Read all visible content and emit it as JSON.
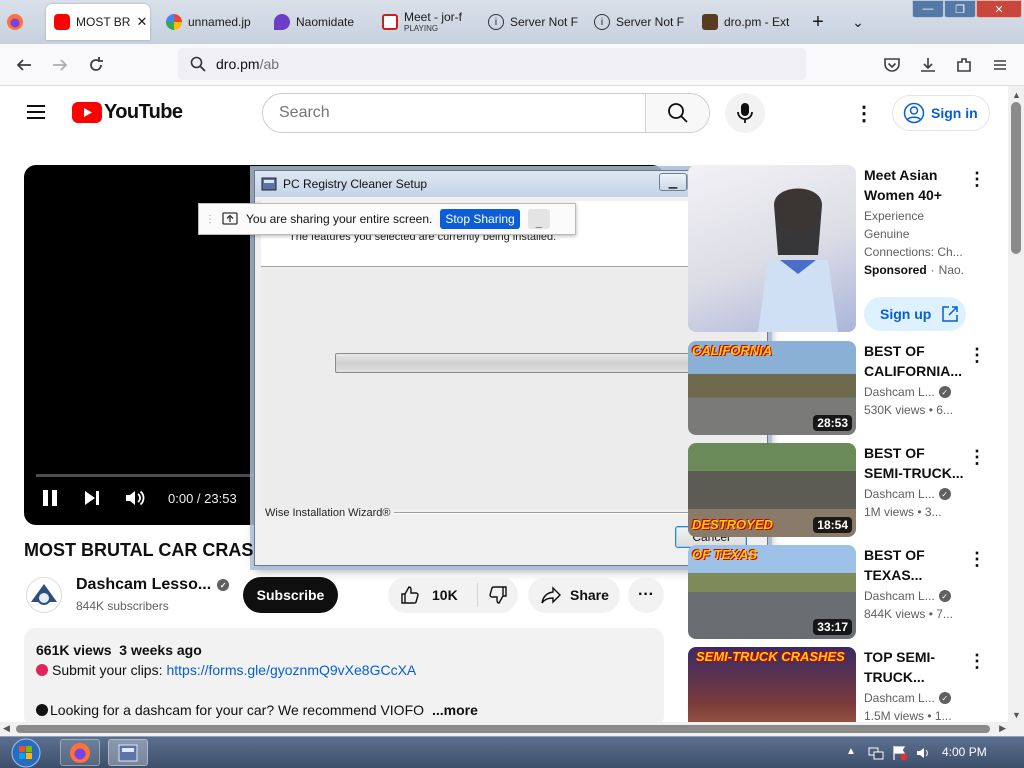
{
  "browser": {
    "tabs": [
      {
        "label": "MOST BR",
        "active": true
      },
      {
        "label": "unnamed.jp"
      },
      {
        "label": "Naomidate"
      },
      {
        "label": "Meet - jor-f",
        "sub": "PLAYING"
      },
      {
        "label": "Server Not F"
      },
      {
        "label": "Server Not F"
      },
      {
        "label": "dro.pm - Ext"
      }
    ],
    "url_host": "dro.pm",
    "url_path": "/ab"
  },
  "youtube": {
    "logo_text": "YouTube",
    "search_placeholder": "Search",
    "sign_in": "Sign in"
  },
  "player": {
    "time": "0:00 / 23:53",
    "progress": 0.0
  },
  "dialog": {
    "title": "PC Registry Cleaner Setup",
    "header_text": "The features you selected are currently being installed.",
    "footer_label": "Wise Installation Wizard®",
    "cancel": "Cancel",
    "progress": 0.0
  },
  "share_bar": {
    "message": "You are sharing your entire screen.",
    "stop": "Stop Sharing",
    "minimize": "_"
  },
  "video": {
    "title": "MOST BRUTAL CAR CRAS",
    "channel": "Dashcam Lesso...",
    "subscribers": "844K subscribers",
    "subscribe": "Subscribe",
    "likes": "10K",
    "share": "Share",
    "description": {
      "stats": "661K views  3 weeks ago",
      "line1_prefix": "Submit your clips: ",
      "line1_link": "https://forms.gle/gyoznmQ9vXe8GCcXA",
      "line2": "Looking for a dashcam for your car? We recommend VIOFO",
      "more": "...more"
    }
  },
  "sidebar": {
    "ad": {
      "title": "Meet Asian Women 40+",
      "line1": "Experience",
      "line2": "Genuine",
      "line3": "Connections: Ch...",
      "sponsored": "Sponsored",
      "advertiser": "Nao...",
      "cta": "Sign up"
    },
    "videos": [
      {
        "title": "BEST OF CALIFORNIA...",
        "channel": "Dashcam L...",
        "meta": "530K views  • 6...",
        "duration": "28:53",
        "thumb_text": "CALIFORNIA"
      },
      {
        "title": "BEST OF SEMI-TRUCK...",
        "channel": "Dashcam L...",
        "meta": "1M views  • 3...",
        "duration": "18:54",
        "thumb_text": "DESTROYED"
      },
      {
        "title": "BEST OF TEXAS...",
        "channel": "Dashcam L...",
        "meta": "844K views  • 7...",
        "duration": "33:17",
        "thumb_text": "OF TEXAS"
      },
      {
        "title": "TOP SEMI-TRUCK...",
        "channel": "Dashcam L...",
        "meta": "1.5M views  • 1...",
        "duration": "",
        "thumb_text": "SEMI-TRUCK CRASHES"
      }
    ]
  },
  "taskbar": {
    "time": "4:00 PM"
  }
}
